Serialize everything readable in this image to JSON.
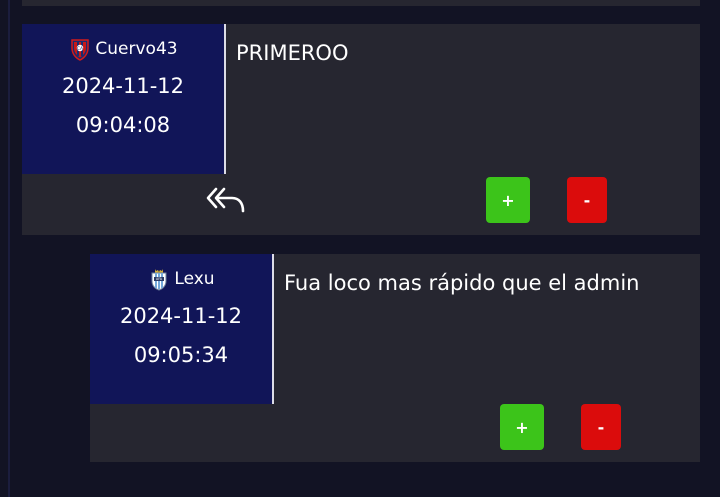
{
  "theme": {
    "page_bg": "#121324",
    "card_bg": "#262630",
    "user_panel_bg": "#111558",
    "upvote_color": "#3cc41a",
    "downvote_color": "#db0c0c"
  },
  "comments": [
    {
      "username": "Cuervo43",
      "badge_icon": "san-lorenzo-crest-icon",
      "date": "2024-11-12",
      "time": "09:04:08",
      "text": "PRIMEROO",
      "reply_icon": "reply-all-icon",
      "upvote_label": "+",
      "downvote_label": "-"
    },
    {
      "username": "Lexu",
      "badge_icon": "argentina-crest-icon",
      "date": "2024-11-12",
      "time": "09:05:34",
      "text": "Fua loco mas rápido que el admin",
      "upvote_label": "+",
      "downvote_label": "-"
    }
  ]
}
